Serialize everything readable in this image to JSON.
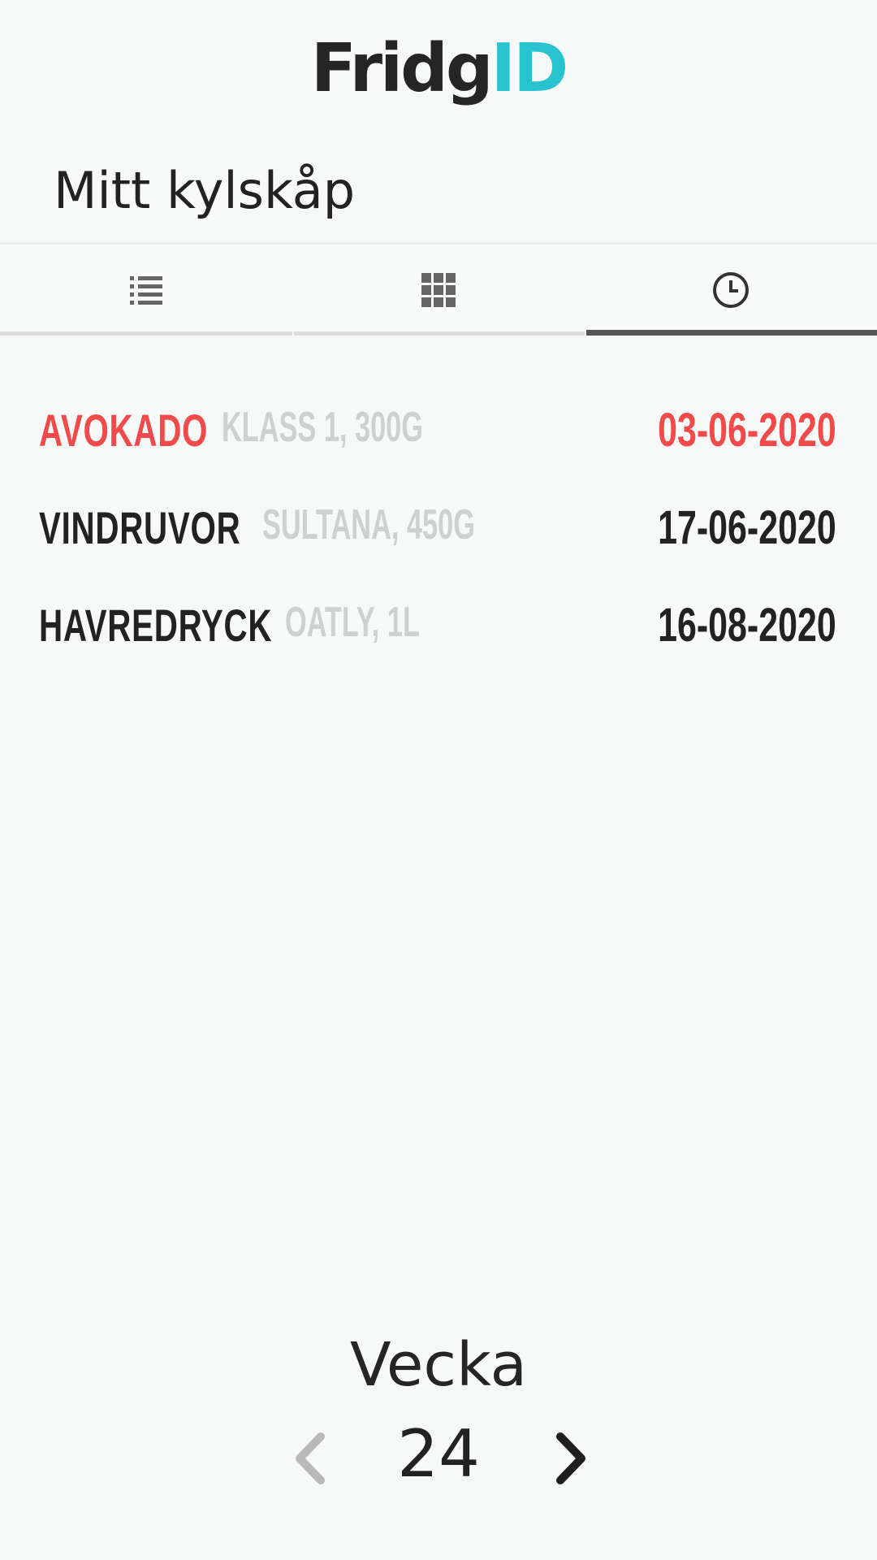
{
  "app": {
    "logo_part1": "Fridg",
    "logo_part2": "ID",
    "page_title": "Mitt kylskåp"
  },
  "tabs": [
    {
      "icon": "list-icon",
      "active": false
    },
    {
      "icon": "grid-icon",
      "active": false
    },
    {
      "icon": "clock-icon",
      "active": true
    }
  ],
  "products": [
    {
      "name": "AVOKADO",
      "desc": "KLASS 1, 300G",
      "date": "03-06-2020",
      "status": "expired"
    },
    {
      "name": "VINDRUVOR",
      "desc": "SULTANA, 450G",
      "date": "17-06-2020",
      "status": "ok"
    },
    {
      "name": "HAVREDRYCK",
      "desc": "OATLY, 1L",
      "date": "16-08-2020",
      "status": "ok"
    }
  ],
  "week": {
    "label": "Vecka",
    "number": "24"
  },
  "colors": {
    "brand_accent": "#29c3cf",
    "expired": "#f04a4a",
    "text": "#222222",
    "muted": "#cfd0d0",
    "prev_disabled": "#b9b9b9"
  }
}
